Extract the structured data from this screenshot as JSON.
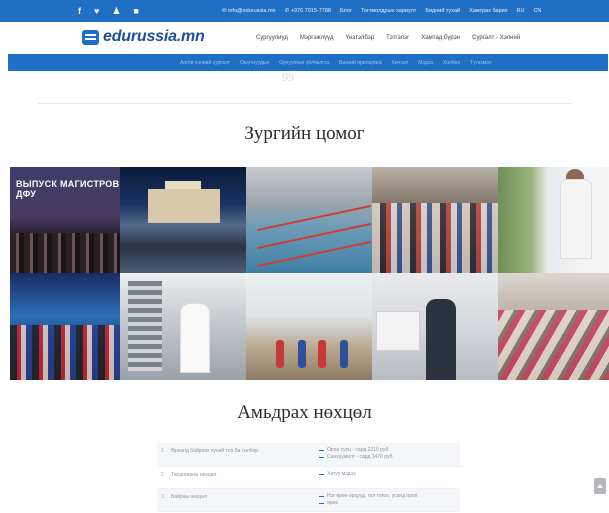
{
  "topbar": {
    "social_icons": [
      "facebook-icon",
      "twitter-icon",
      "user-icon",
      "square-icon"
    ],
    "social_glyphs": [
      "f",
      "♥",
      "♟",
      "■"
    ],
    "email": "✉ info@edurussia.mn",
    "phone": "✆ +976 7015-7788",
    "links": [
      "Блог",
      "Тогтмолдрын хариулт",
      "Бидний тухай",
      "Хамтрах барих",
      "RU",
      "CN"
    ]
  },
  "header": {
    "logo_text": "edurussia.mn",
    "nav": [
      "Сургуулиуд",
      "Мэргэжлүүд",
      "Үнэтэлбэр",
      "Тэтгэлэг",
      "Хамтад бүрэн",
      "Сургалт - Хэлний"
    ]
  },
  "subnav": [
    "Англи хэлний сургалт",
    "Оюутнуудын",
    "Орчуулгын үйлчилгээ",
    "Визний ярилцлага",
    "Хичээл",
    "Мэдээ",
    "Холбоо",
    "Түгээмэл"
  ],
  "ghost_text": "99",
  "gallery": {
    "title": "Зургийн цомог",
    "tile1_caption": "ВЫПУСК МАГИСТРОВ ДФУ"
  },
  "conditions": {
    "title": "Амьдрах нөхцөл",
    "rows": [
      {
        "num": "1",
        "label": "Өрөөнд байрлах хүний тоо ба төлбөр",
        "values": [
          "Орон сууц - сард 2210 руб.",
          "Санхүүжилт - сард 1470 руб."
        ]
      },
      {
        "num": "2",
        "label": "Тасалгааны нөхцөл",
        "values": [
          "Хатуу мэдээ"
        ]
      },
      {
        "num": "3",
        "label": "Байрны нөхцөл",
        "values": [
          "Нэг өрөө орцууд, гал тогоо, усанд орох",
          "өрөө"
        ]
      }
    ]
  },
  "colors": {
    "primary": "#1f6fc5",
    "logo": "#1d4f9c"
  }
}
